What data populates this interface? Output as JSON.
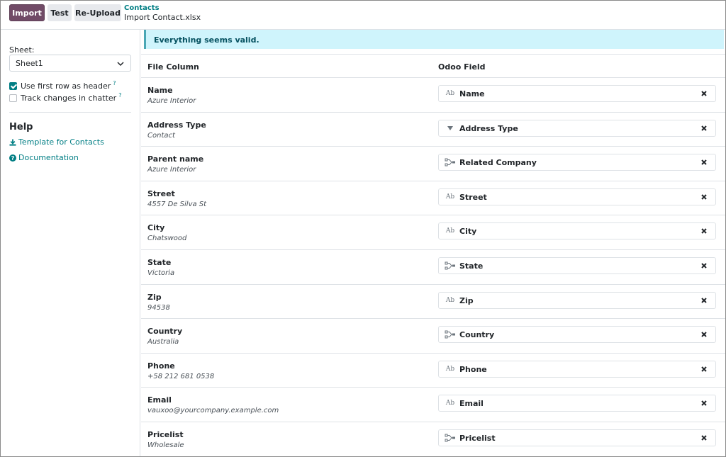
{
  "toolbar": {
    "import_label": "Import",
    "test_label": "Test",
    "reupload_label": "Re-Upload"
  },
  "breadcrumb": {
    "parent": "Contacts",
    "current": "Import Contact.xlsx"
  },
  "sidebar": {
    "sheet_label": "Sheet:",
    "sheet_value": "Sheet1",
    "options": [
      {
        "label": "Use first row as header",
        "checked": true,
        "tip": "?"
      },
      {
        "label": "Track changes in chatter",
        "checked": false,
        "tip": "?"
      }
    ],
    "help_title": "Help",
    "links": [
      {
        "label": "Template for Contacts",
        "icon": "download-icon"
      },
      {
        "label": "Documentation",
        "icon": "question-circle-icon"
      }
    ]
  },
  "alert": {
    "text": "Everything seems valid."
  },
  "table": {
    "headers": [
      "File Column",
      "Odoo Field"
    ],
    "rows": [
      {
        "column": "Name",
        "sample": "Azure Interior",
        "field": "Name",
        "field_icon": "text-field-icon"
      },
      {
        "column": "Address Type",
        "sample": "Contact",
        "field": "Address Type",
        "field_icon": "selection-icon"
      },
      {
        "column": "Parent name",
        "sample": "Azure Interior",
        "field": "Related Company",
        "field_icon": "relation-icon"
      },
      {
        "column": "Street",
        "sample": "4557 De Silva St",
        "field": "Street",
        "field_icon": "text-field-icon"
      },
      {
        "column": "City",
        "sample": "Chatswood",
        "field": "City",
        "field_icon": "text-field-icon"
      },
      {
        "column": "State",
        "sample": "Victoria",
        "field": "State",
        "field_icon": "relation-icon"
      },
      {
        "column": "Zip",
        "sample": "94538",
        "field": "Zip",
        "field_icon": "text-field-icon"
      },
      {
        "column": "Country",
        "sample": "Australia",
        "field": "Country",
        "field_icon": "relation-icon"
      },
      {
        "column": "Phone",
        "sample": "+58 212 681 0538",
        "field": "Phone",
        "field_icon": "text-field-icon"
      },
      {
        "column": "Email",
        "sample": "vauxoo@yourcompany.example.com",
        "field": "Email",
        "field_icon": "text-field-icon"
      },
      {
        "column": "Pricelist",
        "sample": "Wholesale",
        "field": "Pricelist",
        "field_icon": "relation-icon"
      }
    ]
  },
  "colors": {
    "primary": "#714b67",
    "link": "#017e84",
    "alert_bg": "#cff4fc"
  }
}
